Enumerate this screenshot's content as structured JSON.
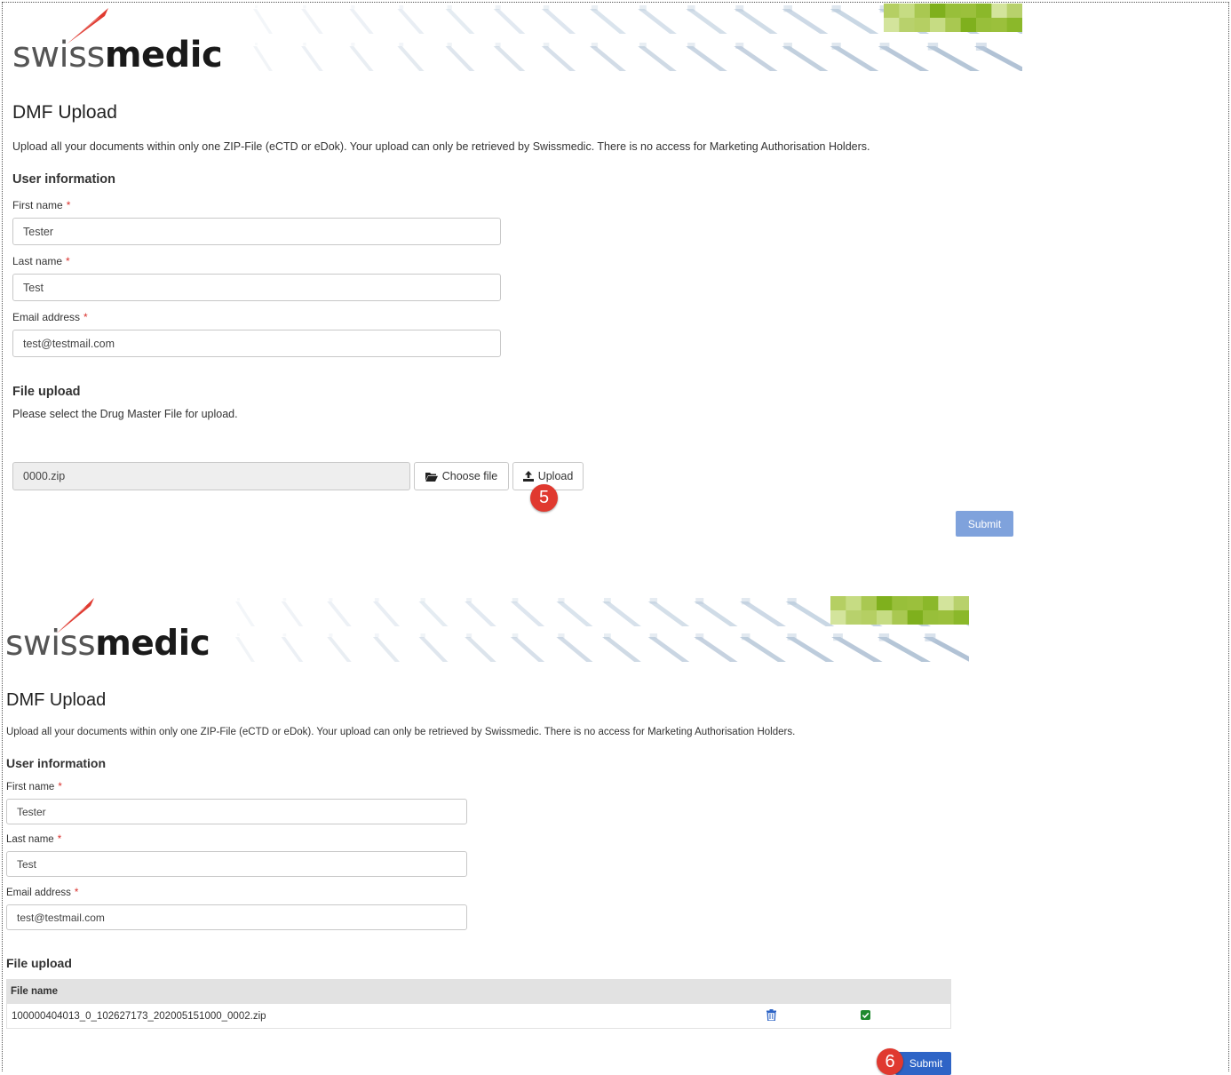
{
  "colors": {
    "primary": "#2e64c6",
    "primary_disabled": "#7fa2dc",
    "marker": "#e0392f",
    "required": "#d9302c",
    "success": "#1f8a2e",
    "logo_accent": "#e0392f"
  },
  "top": {
    "logo": {
      "part1": "swiss",
      "part2": "medic"
    },
    "page_title": "DMF Upload",
    "intro": "Upload all your documents within only one ZIP-File (eCTD or eDok). Your upload can only be retrieved by Swissmedic. There is no access for Marketing Authorisation Holders.",
    "user_info_heading": "User information",
    "first_name": {
      "label": "First name",
      "required_mark": "*",
      "value": "Tester"
    },
    "last_name": {
      "label": "Last name",
      "required_mark": "*",
      "value": "Test"
    },
    "email": {
      "label": "Email address",
      "required_mark": "*",
      "value": "test@testmail.com"
    },
    "file_upload_heading": "File upload",
    "file_upload_hint": "Please select the Drug Master File for upload.",
    "selected_file": "0000.zip",
    "choose_file_label": "Choose file",
    "choose_file_icon": "folder-open-icon",
    "upload_label": "Upload",
    "upload_icon": "upload-icon",
    "step_marker": "5",
    "submit_label": "Submit"
  },
  "bottom": {
    "logo": {
      "part1": "swiss",
      "part2": "medic"
    },
    "page_title": "DMF Upload",
    "intro": "Upload all your documents within only one ZIP-File (eCTD or eDok). Your upload can only be retrieved by Swissmedic. There is no access for Marketing Authorisation Holders.",
    "user_info_heading": "User information",
    "first_name": {
      "label": "First name",
      "required_mark": "*",
      "value": "Tester"
    },
    "last_name": {
      "label": "Last name",
      "required_mark": "*",
      "value": "Test"
    },
    "email": {
      "label": "Email address",
      "required_mark": "*",
      "value": "test@testmail.com"
    },
    "file_upload_heading": "File upload",
    "table": {
      "column_header": "File name",
      "rows": [
        {
          "file_name": "100000404013_0_102627173_202005151000_0002.zip",
          "delete_icon": "trash-icon",
          "status_icon": "check-icon"
        }
      ]
    },
    "step_marker": "6",
    "submit_label": "Submit"
  }
}
